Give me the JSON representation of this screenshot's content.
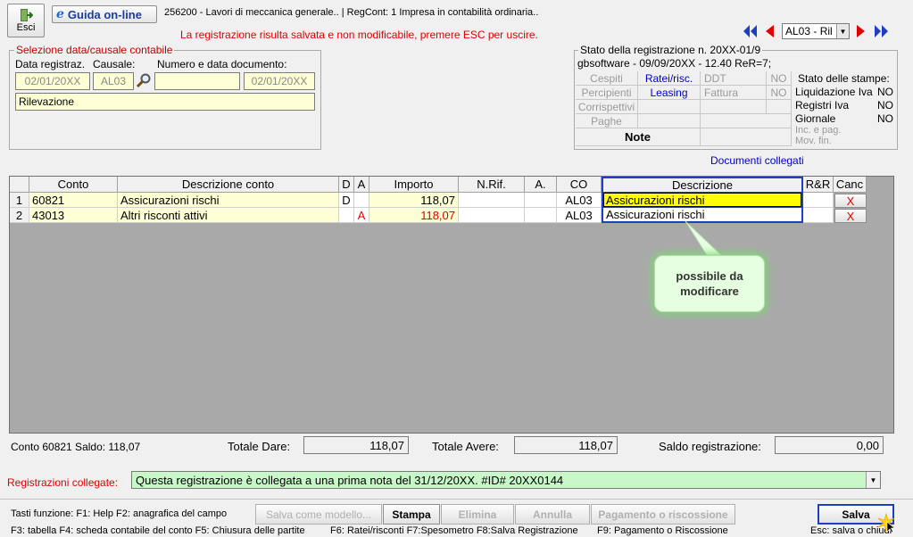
{
  "toolbar": {
    "esci_label": "Esci",
    "guida_label": "Guida on-line",
    "company_info": "256200 - Lavori di meccanica generale.. | RegCont: 1 Impresa  in contabilità ordinaria..",
    "warning": "La registrazione risulta salvata e non modificabile, premere ESC per uscire.",
    "nav_select_value": "AL03 - Ril"
  },
  "selection": {
    "legend": "Selezione data/causale contabile",
    "date_label": "Data registraz.",
    "causale_label": "Causale:",
    "numero_label": "Numero e data documento:",
    "date_value": "02/01/20XX",
    "causale_value": "AL03",
    "numero_value": "",
    "doc_date_value": "02/01/20XX",
    "description_value": "Rilevazione"
  },
  "stato": {
    "legend": "Stato della registrazione n. 20XX-01/9",
    "subtitle": "gbsoftware - 09/09/20XX - 12.40 ReR=7;",
    "cells": {
      "cespiti": "Cespiti",
      "ratei": "Ratei/risc.",
      "ddt": "DDT",
      "ddt_no": "NO",
      "percipienti": "Percipienti",
      "leasing": "Leasing",
      "fattura": "Fattura",
      "fattura_no": "NO",
      "corrispettivi": "Corrispettivi",
      "paghe": "Paghe",
      "note": "Note"
    },
    "stampe_title": "Stato delle stampe:",
    "stampe": [
      {
        "label": "Liquidazione Iva",
        "value": "NO"
      },
      {
        "label": "Registri Iva",
        "value": "NO"
      },
      {
        "label": "Giornale",
        "value": "NO"
      },
      {
        "label": "Inc. e pag.",
        "value": ""
      },
      {
        "label": "Mov. fin.",
        "value": ""
      }
    ]
  },
  "documenti_collegati": "Documenti collegati",
  "table": {
    "headers": {
      "conto": "Conto",
      "descrizione_conto": "Descrizione conto",
      "d": "D",
      "a": "A",
      "importo": "Importo",
      "nrif": "N.Rif.",
      "a2": "A.",
      "co": "CO",
      "descrizione": "Descrizione",
      "rr": "R&R",
      "canc": "Canc"
    },
    "rows": [
      {
        "n": "1",
        "conto": "60821",
        "descrizione_conto": "Assicurazioni rischi",
        "d": "D",
        "a": "",
        "importo": "118,07",
        "nrif": "",
        "a2": "",
        "co": "AL03",
        "descrizione": "Assicurazioni rischi",
        "canc": "X"
      },
      {
        "n": "2",
        "conto": "43013",
        "descrizione_conto": "Altri risconti attivi",
        "d": "",
        "a": "A",
        "importo": "118,07",
        "nrif": "",
        "a2": "",
        "co": "AL03",
        "descrizione": "Assicurazioni rischi",
        "canc": "X"
      }
    ]
  },
  "callout": "possibile da modificare",
  "totals": {
    "conto_saldo": "Conto 60821 Saldo: 118,07",
    "dare_label": "Totale Dare:",
    "dare_value": "118,07",
    "avere_label": "Totale Avere:",
    "avere_value": "118,07",
    "saldo_label": "Saldo registrazione:",
    "saldo_value": "0,00"
  },
  "collegate": {
    "label": "Registrazioni collegate:",
    "value": "Questa registrazione è collegata a una prima nota del 31/12/20XX. #ID# 20XX0144"
  },
  "footer": {
    "line1": "Tasti funzione: F1: Help  F2: anagrafica del campo",
    "line2a": "F3: tabella   F4: scheda contabile del conto  F5: Chiusura delle partite",
    "line2b": "F6: Ratei/risconti   F7:Spesometro   F8:Salva Registrazione",
    "line2c": "F9: Pagamento o Riscossione",
    "line2d": "Esc: salva o chiudi",
    "buttons": {
      "salva_modello": "Salva come modello...",
      "stampa": "Stampa",
      "elimina": "Elimina",
      "annulla": "Annulla",
      "pagamento": "Pagamento o riscossione",
      "salva": "Salva"
    }
  },
  "colors": {
    "warning": "#e00000",
    "accent_blue": "#0000c8",
    "field_yellow": "#ffffd6",
    "selected_yellow": "#ffff00",
    "callout_green": "#e6ffe0",
    "collegate_green": "#c8f7c8"
  }
}
